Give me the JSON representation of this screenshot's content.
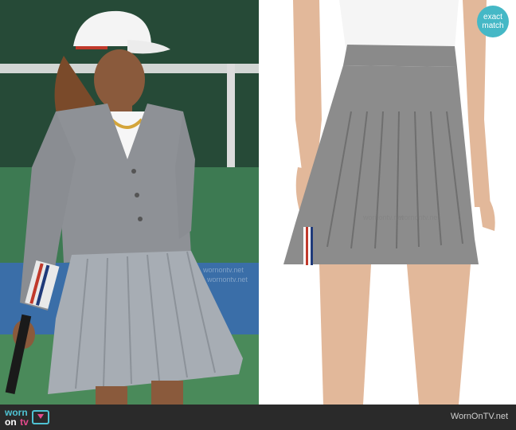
{
  "badge": {
    "line1": "exact",
    "line2": "match"
  },
  "footer": {
    "logo_worn": "worn",
    "logo_on": "on",
    "logo_tv": "tv",
    "site": "WornOnTV.net"
  },
  "watermarks": {
    "left": "wornontv.net",
    "right": "wornontv.net"
  },
  "colors": {
    "badge": "#45b8c6",
    "footer_bg": "#2a2a2a",
    "skirt_grey": "#8c8c8c",
    "court_green": "#2f5a3f",
    "court_blue": "#3a6ea8"
  }
}
